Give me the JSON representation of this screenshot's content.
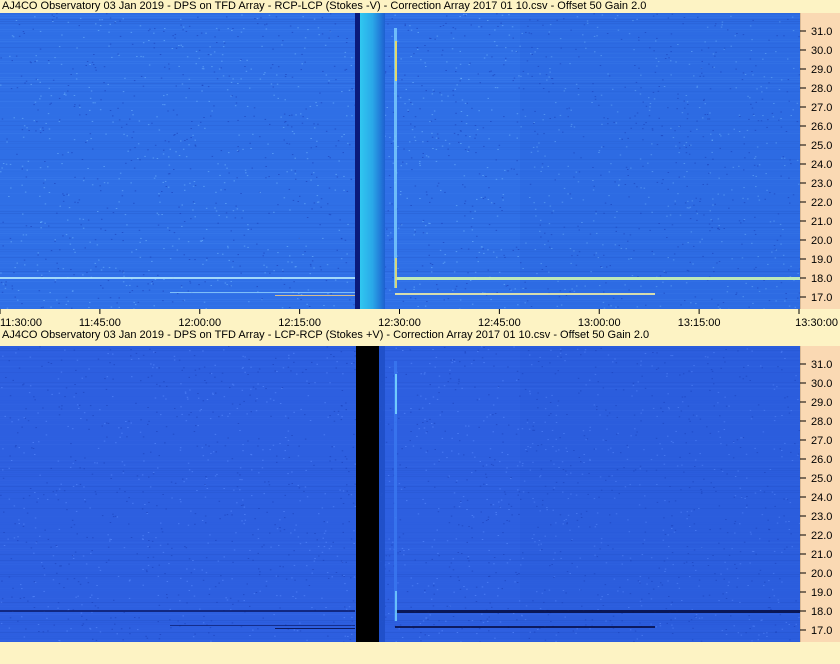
{
  "chart_data": [
    {
      "type": "heatmap",
      "title": "AJ4CO Observatory 03 Jan 2019  -  DPS on TFD Array  -  RCP-LCP (Stokes -V)  -  Correction Array 2017 01 10.csv  -  Offset 50  Gain 2.0",
      "x_ticks": [
        "11:30:00",
        "11:45:00",
        "12:00:00",
        "12:15:00",
        "12:30:00",
        "12:45:00",
        "13:00:00",
        "13:15:00",
        "13:30:00"
      ],
      "y_ticks": [
        "31.0",
        "30.0",
        "29.0",
        "28.0",
        "27.0",
        "26.0",
        "25.0",
        "24.0",
        "23.0",
        "22.0",
        "21.0",
        "20.0",
        "19.0",
        "18.0",
        "17.0"
      ],
      "y_range": [
        16.4,
        31.8
      ],
      "x_range": [
        "11:30:00",
        "13:30:00"
      ],
      "colors": {
        "background": "#2f6fe6",
        "gap": "#0a1a7a"
      }
    },
    {
      "type": "heatmap",
      "title": "AJ4CO Observatory 03 Jan 2019  -  DPS on TFD Array  -  LCP-RCP (Stokes +V)  -  Correction Array 2017 01 10.csv  -  Offset 50  Gain 2.0",
      "x_ticks": [],
      "y_ticks": [
        "31.0",
        "30.0",
        "29.0",
        "28.0",
        "27.0",
        "26.0",
        "25.0",
        "24.0",
        "23.0",
        "22.0",
        "21.0",
        "20.0",
        "19.0",
        "18.0",
        "17.0"
      ],
      "y_range": [
        16.4,
        31.8
      ],
      "x_range": [
        "11:30:00",
        "13:30:00"
      ],
      "colors": {
        "background": "#2d5fe0",
        "gap": "#000000"
      }
    }
  ]
}
